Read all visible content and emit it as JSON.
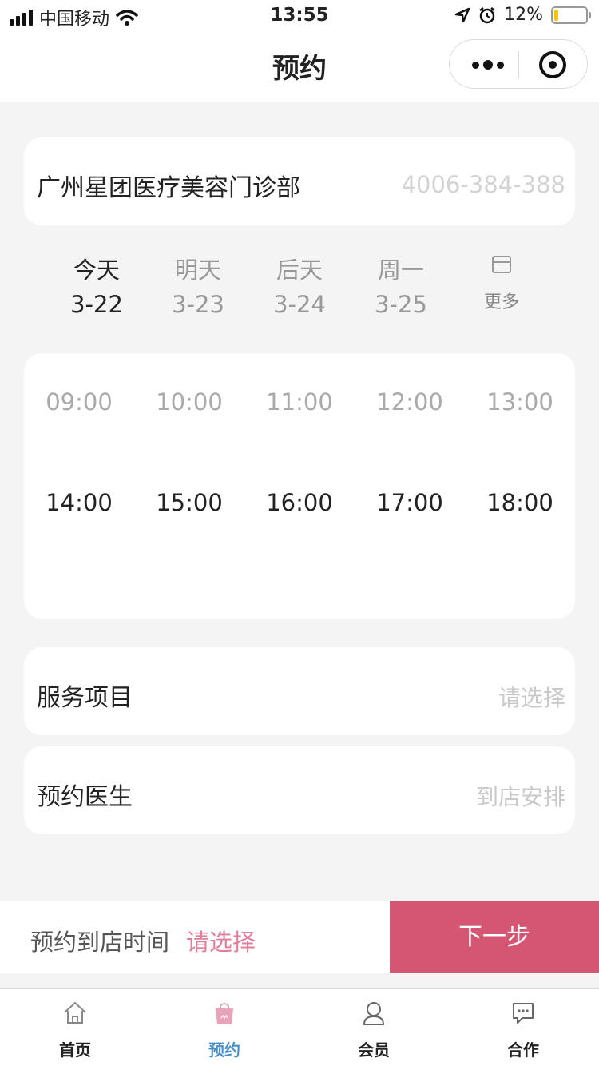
{
  "status": {
    "carrier": "中国移动",
    "time": "13:55",
    "battery_percent": "12%",
    "battery_level": 0.12,
    "battery_color": "#f5c400"
  },
  "nav": {
    "title": "预约"
  },
  "store": {
    "name": "广州星团医疗美容门诊部",
    "phone": "4006-384-388"
  },
  "days": [
    {
      "name": "今天",
      "date": "3-22",
      "active": true
    },
    {
      "name": "明天",
      "date": "3-23",
      "active": false
    },
    {
      "name": "后天",
      "date": "3-24",
      "active": false
    },
    {
      "name": "周一",
      "date": "3-25",
      "active": false
    }
  ],
  "more_label": "更多",
  "slots": [
    {
      "time": "09:00",
      "available": false
    },
    {
      "time": "10:00",
      "available": false
    },
    {
      "time": "11:00",
      "available": false
    },
    {
      "time": "12:00",
      "available": false
    },
    {
      "time": "13:00",
      "available": false
    },
    {
      "time": "14:00",
      "available": true
    },
    {
      "time": "15:00",
      "available": true
    },
    {
      "time": "16:00",
      "available": true
    },
    {
      "time": "17:00",
      "available": true
    },
    {
      "time": "18:00",
      "available": true
    }
  ],
  "service": {
    "label": "服务项目",
    "value": "请选择"
  },
  "doctor": {
    "label": "预约医生",
    "value": "到店安排"
  },
  "booking_bar": {
    "label": "预约到店时间",
    "choose": "请选择",
    "next": "下一步"
  },
  "tabs": [
    {
      "label": "首页",
      "icon": "home-icon",
      "active": false
    },
    {
      "label": "预约",
      "icon": "shopping-bag-icon",
      "active": true
    },
    {
      "label": "会员",
      "icon": "user-icon",
      "active": false
    },
    {
      "label": "合作",
      "icon": "chat-icon",
      "active": false
    }
  ],
  "colors": {
    "accent": "#d45673",
    "accent_light": "#e07f9a",
    "tab_active": "#4a90c8"
  }
}
